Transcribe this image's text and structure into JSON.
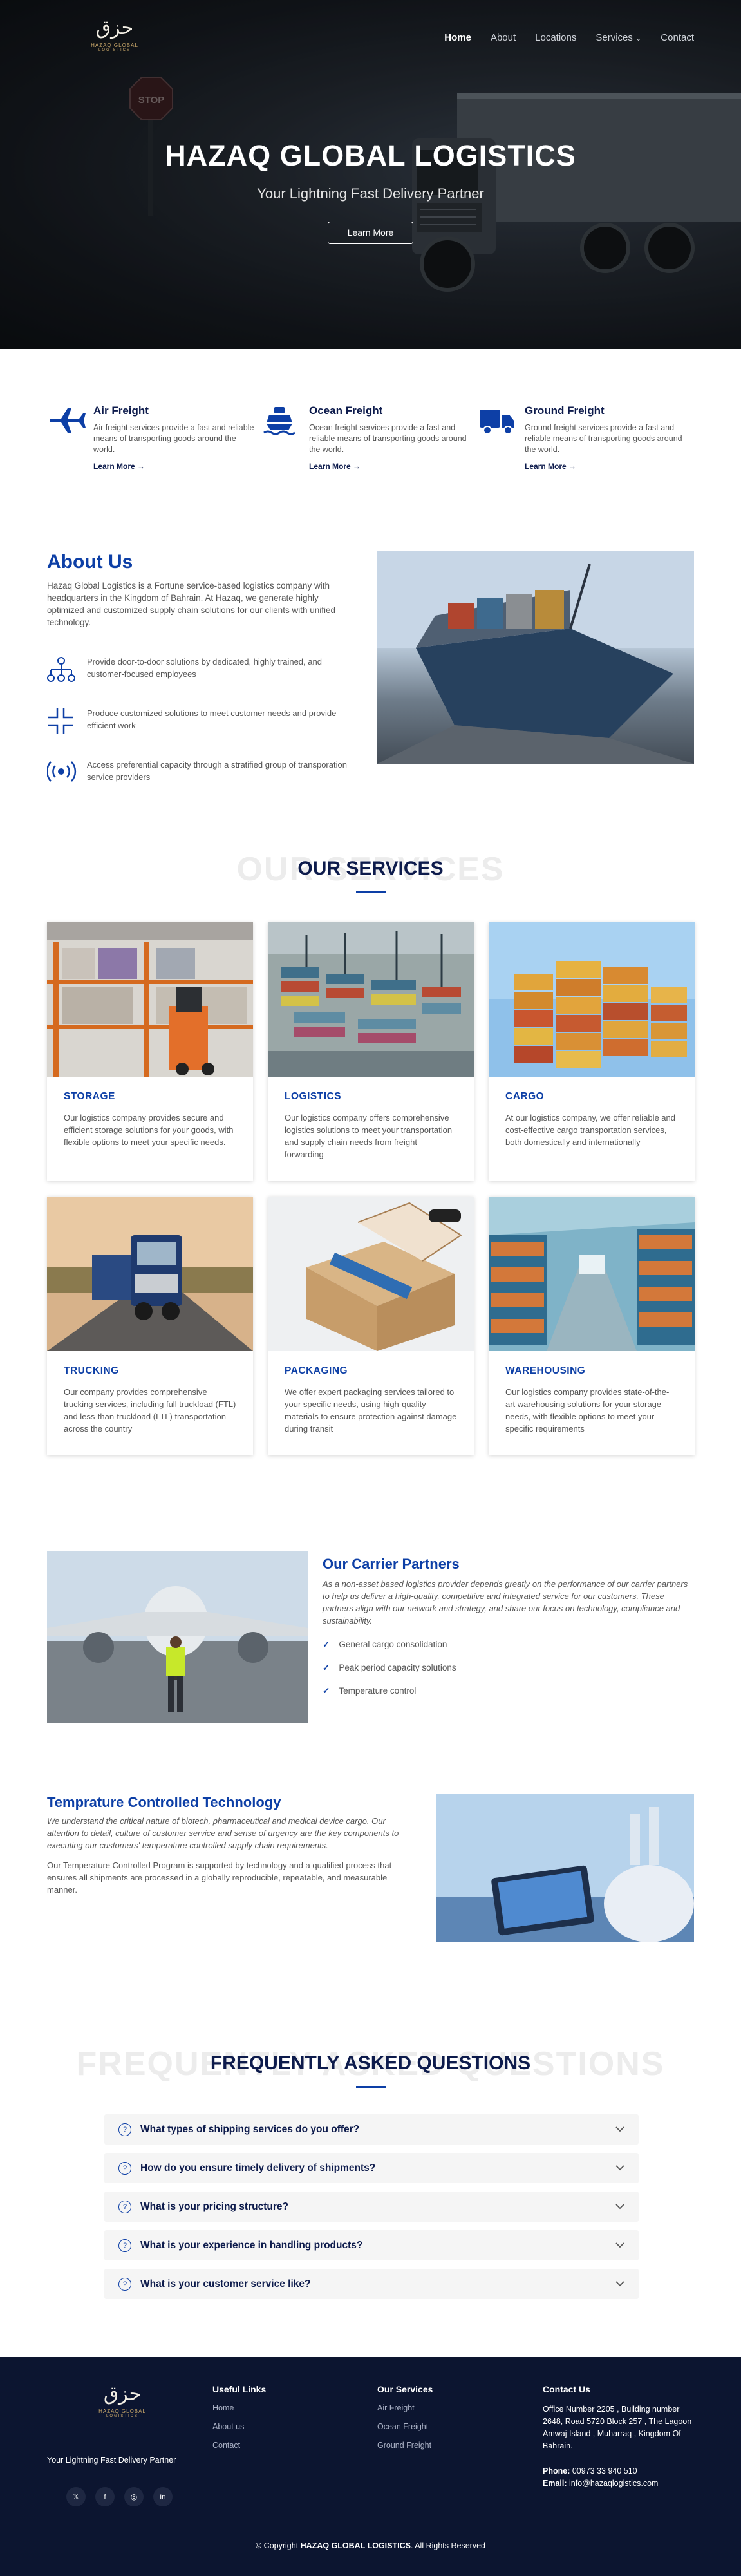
{
  "header": {
    "logo_alt": "Hazaq Global Logistics logo",
    "logo_mark": "حزق",
    "logo_name": "HAZAQ GLOBAL",
    "logo_sub": "LOGISTICS",
    "nav": [
      "Home",
      "About",
      "Locations",
      "Services",
      "Contact"
    ],
    "services_caret": "⌄"
  },
  "hero": {
    "title": "HAZAQ GLOBAL LOGISTICS",
    "subtitle": "Your Lightning Fast Delivery Partner",
    "button": "Learn More"
  },
  "features": [
    {
      "icon": "airplane-icon",
      "title": "Air Freight",
      "text": "Air freight services provide a fast and reliable means of transporting goods around the world.",
      "link": "Learn More →"
    },
    {
      "icon": "ship-icon",
      "title": "Ocean Freight",
      "text": "Ocean freight services provide a fast and reliable means of transporting goods around the world.",
      "link": "Learn More →"
    },
    {
      "icon": "truck-icon",
      "title": "Ground Freight",
      "text": "Ground freight services provide a fast and reliable means of transporting goods around the world.",
      "link": "Learn More →"
    }
  ],
  "about": {
    "title": "About Us",
    "intro": "Hazaq Global Logistics is a Fortune service-based logistics company with headquarters in the Kingdom of Bahrain. At Hazaq, we generate highly optimized and customized supply chain solutions for our clients with unified technology.",
    "items": [
      {
        "icon": "network-icon",
        "text": "Provide door-to-door solutions by dedicated, highly trained, and customer-focused employees"
      },
      {
        "icon": "expand-icon",
        "text": "Produce customized solutions to meet customer needs and provide efficient work"
      },
      {
        "icon": "broadcast-icon",
        "text": "Access preferential capacity through a stratified group of transporation service providers"
      }
    ]
  },
  "services": {
    "ghost": "OUR SERVICES",
    "title": "OUR SERVICES",
    "cards": [
      {
        "title": "STORAGE",
        "text": "Our logistics company provides secure and efficient storage solutions for your goods, with flexible options to meet your specific needs."
      },
      {
        "title": "LOGISTICS",
        "text": "Our logistics company offers comprehensive logistics solutions to meet your transportation and supply chain needs from freight forwarding"
      },
      {
        "title": "CARGO",
        "text": "At our logistics company, we offer reliable and cost-effective cargo transportation services, both domestically and internationally"
      },
      {
        "title": "TRUCKING",
        "text": "Our company provides comprehensive trucking services, including full truckload (FTL) and less-than-truckload (LTL) transportation across the country"
      },
      {
        "title": "PACKAGING",
        "text": "We offer expert packaging services tailored to your specific needs, using high-quality materials to ensure protection against damage during transit"
      },
      {
        "title": "WAREHOUSING",
        "text": "Our logistics company provides state-of-the-art warehousing solutions for your storage needs, with flexible options to meet your specific requirements"
      }
    ]
  },
  "carrier": {
    "title": "Our Carrier Partners",
    "lead": "As a non-asset based logistics provider depends greatly on the performance of our carrier partners to help us deliver a high-quality, competitive and integrated service for our customers. These partners align with our network and strategy, and share our focus on technology, compliance and sustainability.",
    "checks": [
      "General cargo consolidation",
      "Peak period capacity solutions",
      "Temperature control"
    ]
  },
  "temp": {
    "title": "Temprature Controlled Technology",
    "lead": "We understand the critical nature of biotech, pharmaceutical and medical device cargo. Our attention to detail, culture of customer service and sense of urgency are the key components to executing our customers' temperature controlled supply chain requirements.",
    "body": "Our Temperature Controlled Program is supported by technology and a qualified process that ensures all shipments are processed in a globally reproducible, repeatable, and measurable manner."
  },
  "faq": {
    "ghost": "FREQUENTLY ASKED QUESTIONS",
    "title": "FREQUENTLY ASKED QUESTIONS",
    "q_icon": "?",
    "items": [
      "What types of shipping services do you offer?",
      "How do you ensure timely delivery of shipments?",
      "What is your pricing structure?",
      "What is your experience in handling products?",
      "What is your customer service like?"
    ]
  },
  "footer": {
    "tagline": "Your Lightning Fast Delivery Partner",
    "socials": [
      "𝕏",
      "f",
      "◎",
      "in"
    ],
    "useful_title": "Useful Links",
    "useful": [
      "Home",
      "About us",
      "Contact"
    ],
    "services_title": "Our Services",
    "services": [
      "Air Freight",
      "Ocean Freight",
      "Ground Freight"
    ],
    "contact_title": "Contact Us",
    "address": "Office Number 2205 , Building number 2648, Road 5720 Block 257 , The Lagoon Amwaj Island , Muharraq , Kingdom Of Bahrain.",
    "phone_label": "Phone:",
    "phone": "00973 33 940 510",
    "email_label": "Email:",
    "email": "info@hazaqlogistics.com",
    "copy_pre": "© Copyright ",
    "copy_brand": "HAZAQ GLOBAL LOGISTICS",
    "copy_post": ". All Rights Reserved"
  },
  "colors": {
    "navy": "#0d1b4c",
    "accent": "#0d3fa6",
    "footer": "#0c1530"
  }
}
